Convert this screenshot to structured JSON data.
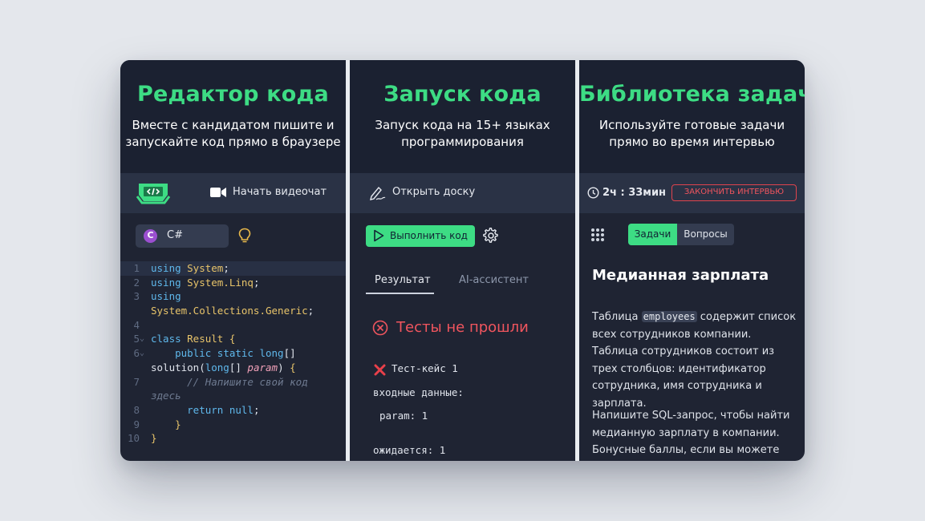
{
  "editor": {
    "title": "Редактор кода",
    "subtitle": "Вместе с кандидатом пишите и запускайте код прямо в браузере",
    "video_chat_label": "Начать видеочат",
    "language": "C#",
    "language_icon_letter": "C",
    "code_lines": [
      {
        "n": "1",
        "fold": "",
        "tokens": [
          [
            "kw",
            "using "
          ],
          [
            "ty",
            "System"
          ],
          [
            "",
            "; "
          ]
        ]
      },
      {
        "n": "2",
        "fold": "",
        "tokens": [
          [
            "kw",
            "using "
          ],
          [
            "ty",
            "System.Linq"
          ],
          [
            "",
            ";"
          ]
        ]
      },
      {
        "n": "3",
        "fold": "",
        "tokens": [
          [
            "kw",
            "using"
          ]
        ]
      },
      {
        "n": "",
        "fold": "",
        "tokens": [
          [
            "ty",
            "System.Collections.Generic"
          ],
          [
            "",
            ";"
          ]
        ]
      },
      {
        "n": "4",
        "fold": "",
        "tokens": []
      },
      {
        "n": "5",
        "fold": "⌄",
        "tokens": [
          [
            "kw",
            "class "
          ],
          [
            "ty",
            "Result "
          ],
          [
            "br",
            "{"
          ]
        ]
      },
      {
        "n": "6",
        "fold": "⌄",
        "tokens": [
          [
            "",
            "    "
          ],
          [
            "kw",
            "public static long"
          ],
          [
            "",
            "[]"
          ]
        ]
      },
      {
        "n": "",
        "fold": "",
        "tokens": [
          [
            "",
            "solution("
          ],
          [
            "kw",
            "long"
          ],
          [
            "",
            "[] "
          ],
          [
            "it",
            "param"
          ],
          [
            "",
            ") "
          ],
          [
            "br",
            "{"
          ]
        ]
      },
      {
        "n": "7",
        "fold": "",
        "tokens": [
          [
            "",
            "      "
          ],
          [
            "cm",
            "// Напишите свой код"
          ]
        ]
      },
      {
        "n": "",
        "fold": "",
        "tokens": [
          [
            "cm",
            "здесь"
          ]
        ]
      },
      {
        "n": "8",
        "fold": "",
        "tokens": [
          [
            "",
            "      "
          ],
          [
            "kw",
            "return null"
          ],
          [
            "",
            ";"
          ]
        ]
      },
      {
        "n": "9",
        "fold": "",
        "tokens": [
          [
            "",
            "    "
          ],
          [
            "br",
            "}"
          ]
        ]
      },
      {
        "n": "10",
        "fold": "",
        "tokens": [
          [
            "br",
            "}"
          ]
        ]
      }
    ]
  },
  "runner": {
    "title": "Запуск кода",
    "subtitle": "Запуск кода на 15+ языках программирования",
    "whiteboard_label": "Открыть доску",
    "run_label": "Выполнить код",
    "tab_result": "Результат",
    "tab_ai": "AI-ассистент",
    "fail_text": "Тесты не прошли",
    "test_case": "Тест-кейс 1",
    "input_label": "входные данные:",
    "param_line": "param: 1",
    "expected_line": "ожидается: 1"
  },
  "library": {
    "title": "Библиотека задач",
    "subtitle": "Используйте готовые задачи прямо во время интервью",
    "timer": "2ч : 33мин",
    "end_label": "ЗАКОНЧИТЬ ИНТЕРВЬЮ",
    "tab_tasks": "Задачи",
    "tab_questions": "Вопросы",
    "problem_title": "Медианная зарплата",
    "desc1_before": "Таблица ",
    "desc1_code": "employees",
    "desc1_after": " содержит список всех сотрудников компании. Таблица сотрудников состоит из трех столбцов: идентификатор сотрудника, имя сотрудника и зарплата.",
    "desc2": "Напишите SQL-запрос, чтобы найти медианную зарплату в компании. Бонусные баллы, если вы можете решить"
  },
  "colors": {
    "accent": "#3ddc84",
    "danger": "#f0555e",
    "panel": "#1f2433",
    "bar": "#2a3245"
  }
}
